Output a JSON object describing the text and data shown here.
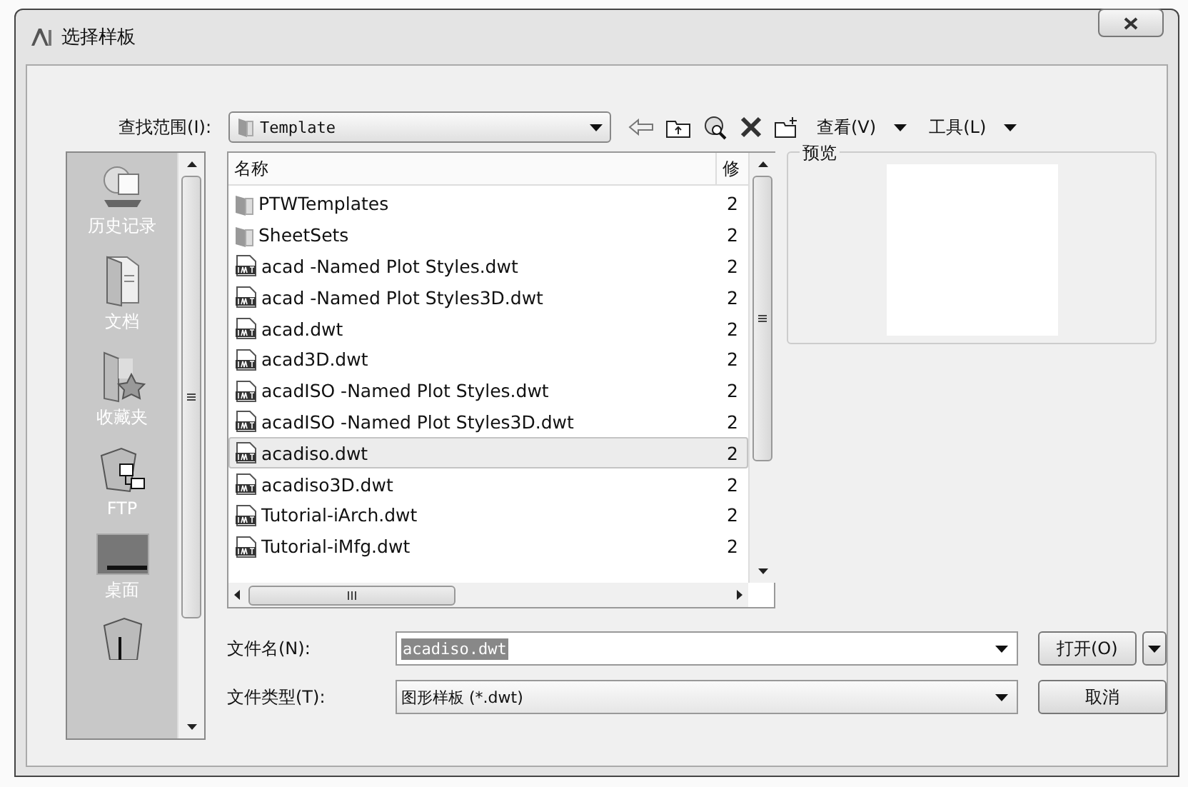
{
  "window": {
    "title": "选择样板"
  },
  "toolbar": {
    "look_in_label": "查找范围(I):",
    "look_in_value": "Template",
    "menus": [
      {
        "label": "查看(V)"
      },
      {
        "label": "工具(L)"
      }
    ]
  },
  "places": [
    {
      "kind": "history",
      "label": "历史记录"
    },
    {
      "kind": "documents",
      "label": "文档"
    },
    {
      "kind": "favorites",
      "label": "收藏夹"
    },
    {
      "kind": "ftp",
      "label": "FTP"
    },
    {
      "kind": "desktop",
      "label": "桌面"
    },
    {
      "kind": "buzzsaw"
    }
  ],
  "file_list": {
    "columns": [
      "名称",
      "修"
    ],
    "rows": [
      {
        "kind": "folder",
        "name": "PTWTemplates",
        "column_2": "2",
        "selected": false
      },
      {
        "kind": "folder",
        "name": "SheetSets",
        "column_2": "2",
        "selected": false
      },
      {
        "kind": "dwt",
        "name": "acad -Named Plot Styles.dwt",
        "column_2": "2",
        "selected": false
      },
      {
        "kind": "dwt",
        "name": "acad -Named Plot Styles3D.dwt",
        "column_2": "2",
        "selected": false
      },
      {
        "kind": "dwt",
        "name": "acad.dwt",
        "column_2": "2",
        "selected": false
      },
      {
        "kind": "dwt",
        "name": "acad3D.dwt",
        "column_2": "2",
        "selected": false
      },
      {
        "kind": "dwt",
        "name": "acadISO -Named Plot Styles.dwt",
        "column_2": "2",
        "selected": false
      },
      {
        "kind": "dwt",
        "name": "acadISO -Named Plot Styles3D.dwt",
        "column_2": "2",
        "selected": false
      },
      {
        "kind": "dwt",
        "name": "acadiso.dwt",
        "column_2": "2",
        "selected": true
      },
      {
        "kind": "dwt",
        "name": "acadiso3D.dwt",
        "column_2": "2",
        "selected": false
      },
      {
        "kind": "dwt",
        "name": "Tutorial-iArch.dwt",
        "column_2": "2",
        "selected": false
      },
      {
        "kind": "dwt",
        "name": "Tutorial-iMfg.dwt",
        "column_2": "2",
        "selected": false
      }
    ]
  },
  "preview": {
    "label": "预览"
  },
  "file_name": {
    "label": "文件名(N):",
    "value": "acadiso.dwt"
  },
  "file_type": {
    "label": "文件类型(T):",
    "value": "图形样板 (*.dwt)"
  },
  "buttons": {
    "open": "打开(O)",
    "cancel": "取消"
  }
}
